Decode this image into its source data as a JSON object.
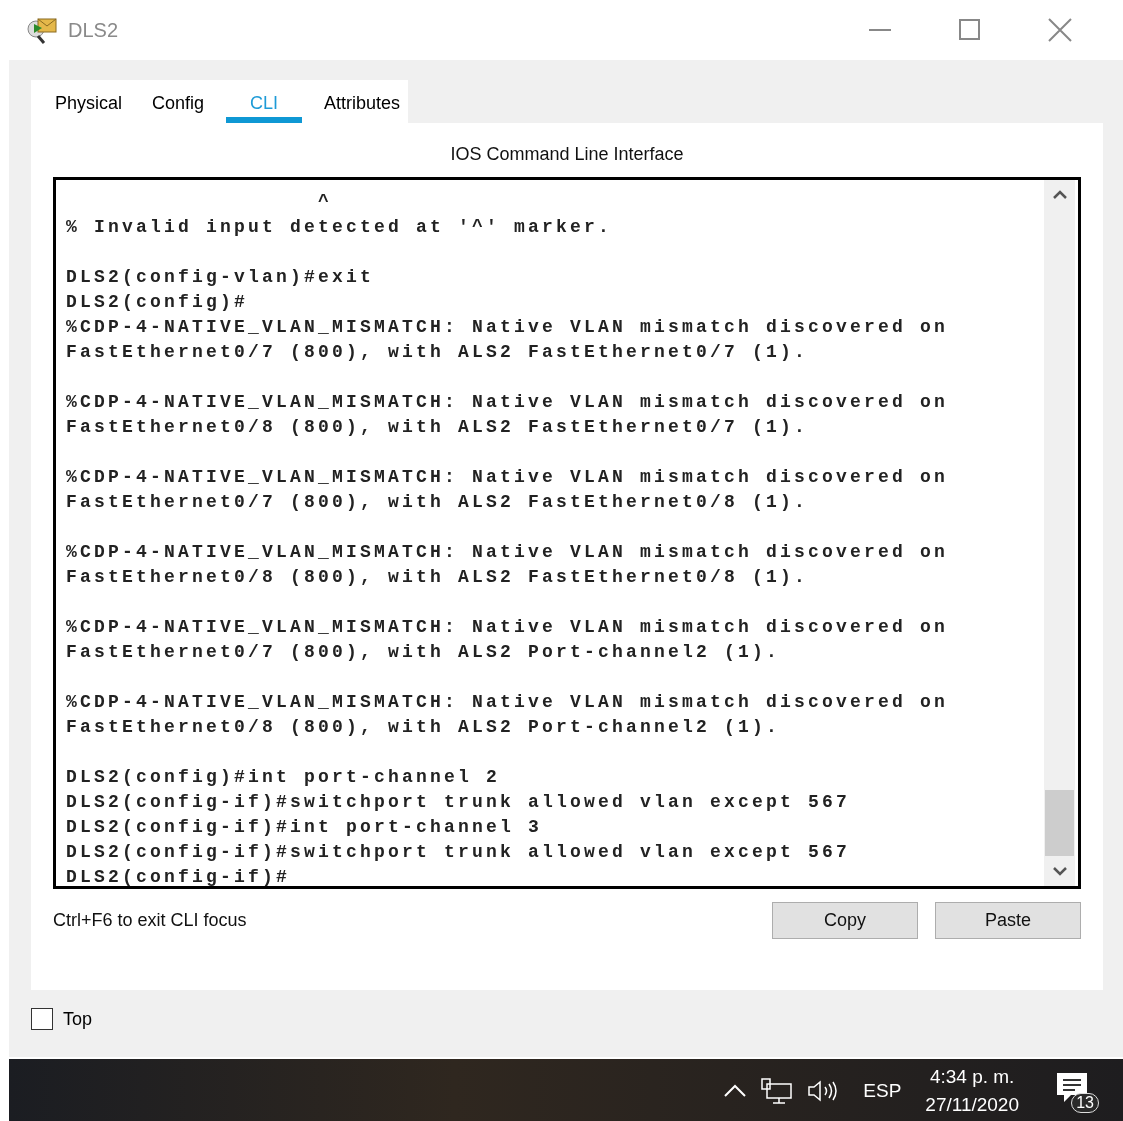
{
  "window": {
    "title": "DLS2"
  },
  "tabs": [
    {
      "label": "Physical",
      "selected": false
    },
    {
      "label": "Config",
      "selected": false
    },
    {
      "label": "CLI",
      "selected": true
    },
    {
      "label": "Attributes",
      "selected": false
    }
  ],
  "cli": {
    "heading": "IOS Command Line Interface",
    "blocks": [
      [
        "                  ^",
        "% Invalid input detected at '^' marker."
      ],
      [
        "DLS2(config-vlan)#exit",
        "DLS2(config)#",
        "%CDP-4-NATIVE_VLAN_MISMATCH: Native VLAN mismatch discovered on",
        "FastEthernet0/7 (800), with ALS2 FastEthernet0/7 (1)."
      ],
      [
        "%CDP-4-NATIVE_VLAN_MISMATCH: Native VLAN mismatch discovered on",
        "FastEthernet0/8 (800), with ALS2 FastEthernet0/7 (1)."
      ],
      [
        "%CDP-4-NATIVE_VLAN_MISMATCH: Native VLAN mismatch discovered on",
        "FastEthernet0/7 (800), with ALS2 FastEthernet0/8 (1)."
      ],
      [
        "%CDP-4-NATIVE_VLAN_MISMATCH: Native VLAN mismatch discovered on",
        "FastEthernet0/8 (800), with ALS2 FastEthernet0/8 (1)."
      ],
      [
        "%CDP-4-NATIVE_VLAN_MISMATCH: Native VLAN mismatch discovered on",
        "FastEthernet0/7 (800), with ALS2 Port-channel2 (1)."
      ],
      [
        "%CDP-4-NATIVE_VLAN_MISMATCH: Native VLAN mismatch discovered on",
        "FastEthernet0/8 (800), with ALS2 Port-channel2 (1)."
      ],
      [
        "DLS2(config)#int port-channel 2",
        "DLS2(config-if)#switchport trunk allowed vlan except 567",
        "DLS2(config-if)#int port-channel 3",
        "DLS2(config-if)#switchport trunk allowed vlan except 567",
        "DLS2(config-if)#"
      ]
    ],
    "hint": "Ctrl+F6 to exit CLI focus",
    "buttons": [
      "Copy",
      "Paste"
    ]
  },
  "top_checkbox": {
    "label": "Top",
    "checked": false
  },
  "taskbar": {
    "language": "ESP",
    "time": "4:34 p. m.",
    "date": "27/11/2020",
    "notification_count": "13"
  }
}
